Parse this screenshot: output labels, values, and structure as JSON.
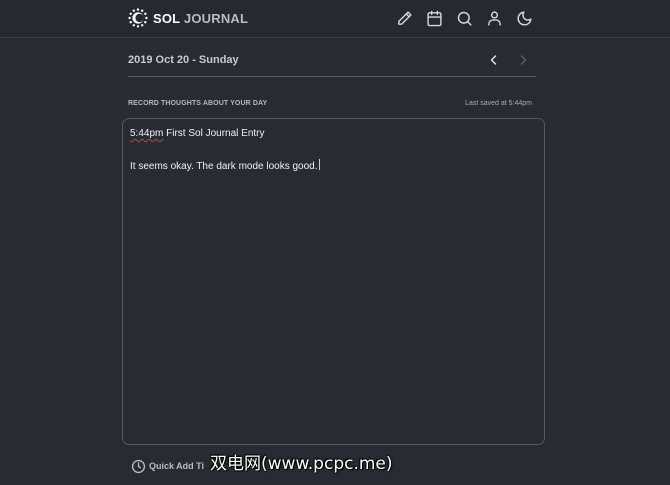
{
  "app": {
    "logo_sol": "SOL",
    "logo_journal": "JOURNAL"
  },
  "nav": {
    "icons": [
      "pencil-icon",
      "calendar-icon",
      "search-icon",
      "user-icon",
      "moon-icon"
    ]
  },
  "date_nav": {
    "title": "2019 Oct 20 - Sunday",
    "prev_icon": "chevron-left-icon",
    "next_icon": "chevron-right-icon"
  },
  "editor": {
    "label": "RECORD THOUGHTS ABOUT YOUR DAY",
    "saved_status": "Last saved at 5:44pm",
    "line1_time": "5:44pm",
    "line1_rest": " First Sol Journal Entry",
    "line2": "It seems okay. The dark mode looks good."
  },
  "quick_add": {
    "label": "Quick Add Ti",
    "icon": "clock-icon"
  },
  "watermark": {
    "text": "双电网(www.pcpc.me)"
  },
  "colors": {
    "background": "#292b33",
    "header": "#272930",
    "text": "#e7e8ec",
    "muted": "#b5b8c2",
    "border": "#555966"
  }
}
